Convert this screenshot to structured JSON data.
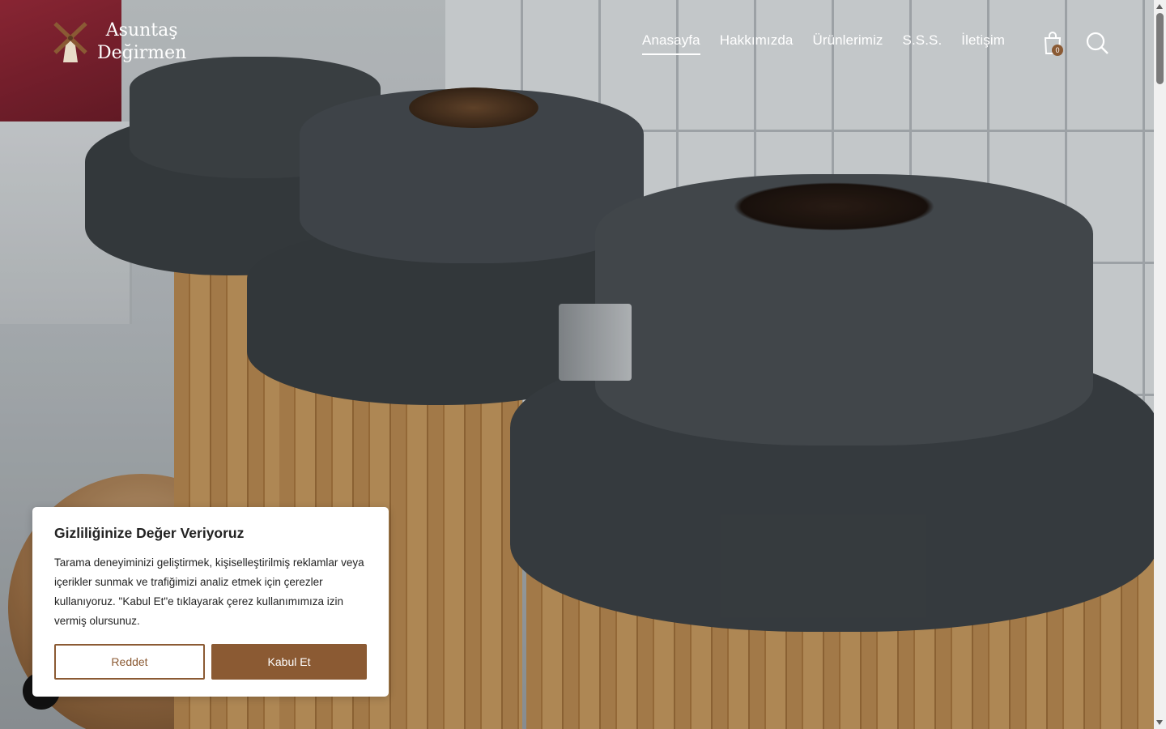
{
  "brand": {
    "name_line1": "Asuntaş",
    "name_line2": "Değirmen"
  },
  "nav": {
    "items": [
      {
        "label": "Anasayfa",
        "active": true
      },
      {
        "label": "Hakkımızda",
        "active": false
      },
      {
        "label": "Ürünlerimiz",
        "active": false
      },
      {
        "label": "S.S.S.",
        "active": false
      },
      {
        "label": "İletişim",
        "active": false
      }
    ]
  },
  "cart": {
    "icon": "shopping-bag-icon",
    "count": "0"
  },
  "search": {
    "icon": "search-icon"
  },
  "cookie_banner": {
    "title": "Gizliliğinize Değer Veriyoruz",
    "body": "Tarama deneyiminizi geliştirmek, kişiselleştirilmiş reklamlar veya içerikler sunmak ve trafiğimizi analiz etmek için çerezler kullanıyoruz. \"Kabul Et\"e tıklayarak çerez kullanımımıza izin vermiş olursunuz.",
    "reject_label": "Reddet",
    "accept_label": "Kabul Et"
  },
  "chat": {
    "icon": "chat-icon"
  },
  "colors": {
    "accent": "#8b5a33",
    "header_text": "#ffffff"
  }
}
